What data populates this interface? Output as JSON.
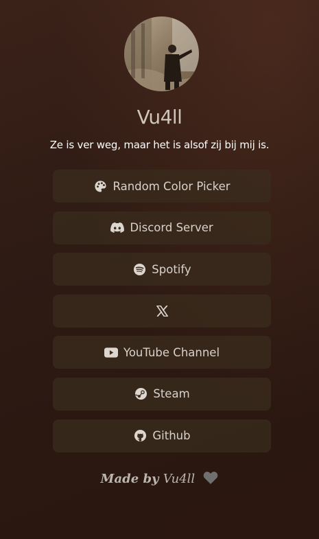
{
  "profile": {
    "username": "Vu4ll",
    "bio": "Ze is ver weg, maar het is alsof zij bij mij is."
  },
  "links": [
    {
      "label": "Random Color Picker",
      "icon": "palette-icon"
    },
    {
      "label": "Discord Server",
      "icon": "discord-icon"
    },
    {
      "label": "Spotify",
      "icon": "spotify-icon"
    },
    {
      "label": "",
      "icon": "x-icon"
    },
    {
      "label": "YouTube Channel",
      "icon": "youtube-icon"
    },
    {
      "label": "Steam",
      "icon": "steam-icon"
    },
    {
      "label": "Github",
      "icon": "github-icon"
    }
  ],
  "footer": {
    "made_by": "Made by",
    "author": "Vu4ll",
    "heart_icon": "heart-icon"
  },
  "colors": {
    "background": "#2e1b14",
    "button": "#3a2c1e",
    "text": "#d9d2cb"
  }
}
